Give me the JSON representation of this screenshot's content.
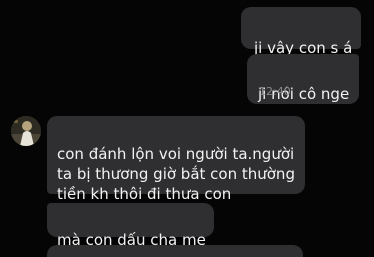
{
  "messages": [
    {
      "direction": "outgoing",
      "text": "ji vậy con s á"
    },
    {
      "direction": "outgoing",
      "text": "ji nói cô nge",
      "time": "12:40"
    },
    {
      "direction": "incoming",
      "text": "con đánh lộn voi người ta.người\nta bị thương giờ bắt con thường\ntiền kh thôi đi thưa con"
    },
    {
      "direction": "incoming",
      "text": "mà con dấu cha mẹ"
    },
    {
      "direction": "incoming",
      "text": ""
    }
  ],
  "colors": {
    "background": "#050505",
    "bubble": "#2f2f31",
    "text": "#f2f2f2",
    "timestamp": "#8a8a8e"
  },
  "icons": [
    "contact-avatar"
  ]
}
